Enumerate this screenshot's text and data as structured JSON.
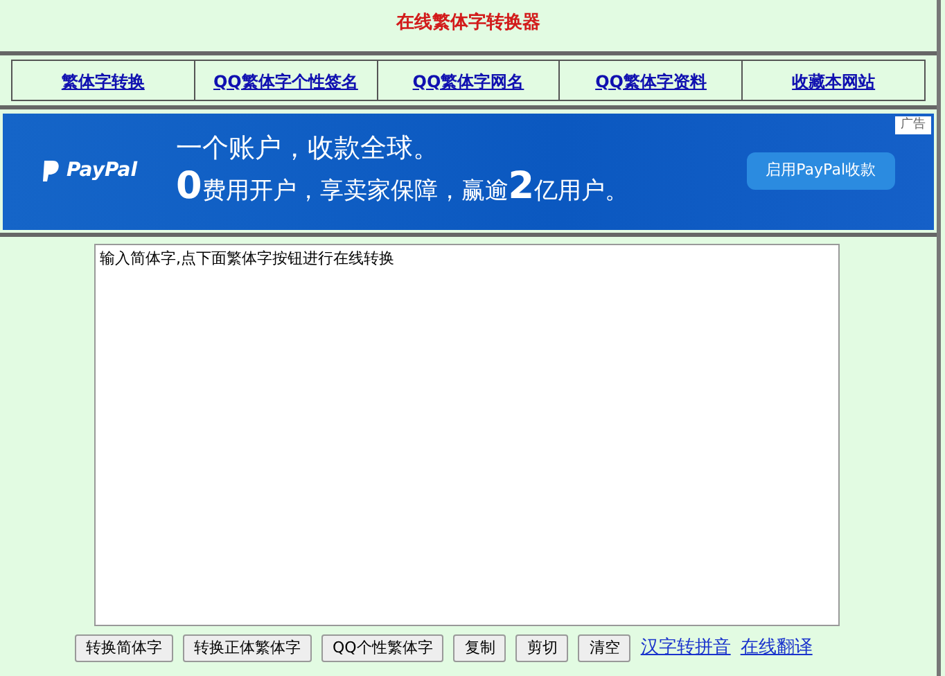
{
  "title": "在线繁体字转换器",
  "nav": [
    {
      "label": "繁体字转换"
    },
    {
      "label": "QQ繁体字个性签名"
    },
    {
      "label": "QQ繁体字网名"
    },
    {
      "label": "QQ繁体字资料"
    },
    {
      "label": "收藏本网站"
    }
  ],
  "ad": {
    "brand": "PayPal",
    "headline": "一个账户，收款全球。",
    "tagline": [
      {
        "kind": "big",
        "text": "0"
      },
      {
        "kind": "normal",
        "text": "费用开户，享卖家保障，赢逾"
      },
      {
        "kind": "big",
        "text": "2"
      },
      {
        "kind": "normal",
        "text": "亿用户。"
      }
    ],
    "button": "启用PayPal收款",
    "badge": "广告"
  },
  "editor": {
    "value": "输入简体字,点下面繁体字按钮进行在线转换"
  },
  "buttons": [
    "转换简体字",
    "转换正体繁体字",
    "QQ个性繁体字",
    "复制",
    "剪切",
    "清空"
  ],
  "links": [
    "汉字转拼音",
    "在线翻译"
  ]
}
